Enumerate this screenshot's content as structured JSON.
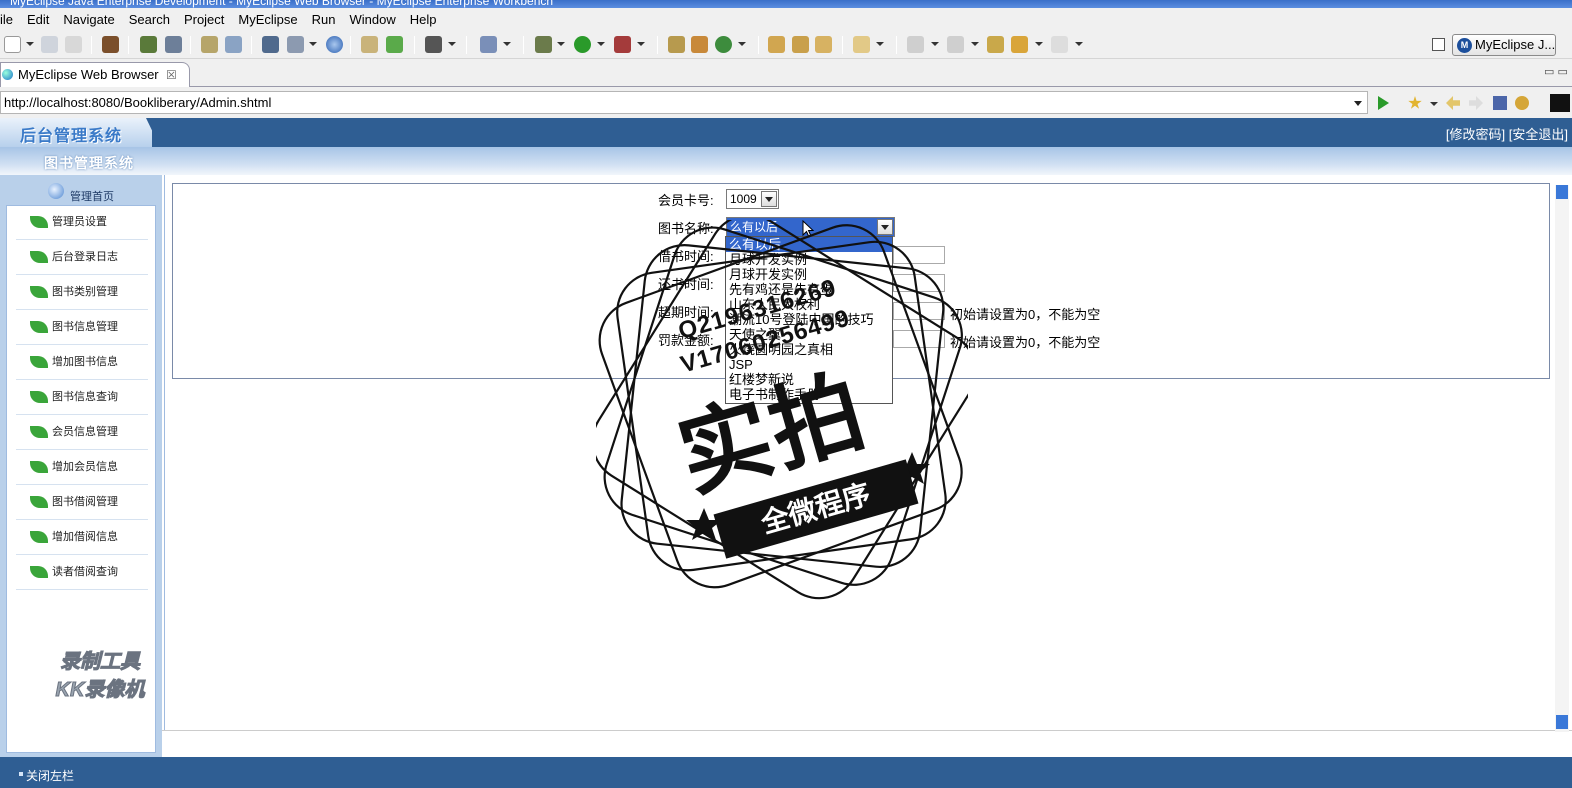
{
  "window": {
    "title": "MyEclipse Java Enterprise Development - MyEclipse Web Browser - MyEclipse Enterprise Workbench"
  },
  "menu": [
    "ile",
    "Edit",
    "Navigate",
    "Search",
    "Project",
    "MyEclipse",
    "Run",
    "Window",
    "Help"
  ],
  "perspective": {
    "label": "MyEclipse J..."
  },
  "editor_tab": {
    "label": "MyEclipse Web Browser",
    "close": "☒"
  },
  "address": {
    "url": "http://localhost:8080/Bookliberary/Admin.shtml"
  },
  "web": {
    "logo": "后台管理系统",
    "system_name": "图书管理系统",
    "top_links": {
      "change_password": "[修改密码]",
      "logout": "[安全退出]"
    },
    "sidebar": {
      "home": "管理首页",
      "items": [
        "管理员设置",
        "后台登录日志",
        "图书类别管理",
        "图书信息管理",
        "增加图书信息",
        "图书信息查询",
        "会员信息管理",
        "增加会员信息",
        "图书借阅管理",
        "增加借阅信息",
        "读者借阅查询"
      ]
    },
    "form": {
      "member_card_label": "会员卡号:",
      "member_card_value": "1009",
      "book_name_label": "图书名称:",
      "book_name_value": "么有以后",
      "borrow_time_label": "借书时间:",
      "return_time_label": "还书时间:",
      "overdue_time_label": "超期时间:",
      "fine_label": "罚款金额:",
      "overdue_hint": "初始请设置为0，不能为空",
      "fine_hint": "初始请设置为0，不能为空",
      "book_options": [
        "么有以后",
        "月球开发实例",
        "月球开发实例",
        "先有鸡还是先有蛋",
        "山东人民大权利",
        "潮流10号登陆中国的技巧",
        "天使之翼",
        "火烧圆明园之真相",
        "JSP",
        "红楼梦新说",
        "电子书制作手册"
      ]
    },
    "close_sidebar": "关闭左栏"
  },
  "overlays": {
    "kk_watermark": [
      "录制工具",
      "KK录像机"
    ],
    "stamp": {
      "q": "Q2196316269",
      "v": "V17060256499",
      "main": "实拍",
      "ribbon": "全微程序"
    }
  },
  "icons": [
    "new-icon",
    "save-icon",
    "print-icon",
    "package-icon",
    "debug-icon",
    "run-icon",
    "search-icon",
    "browser-back-icon",
    "browser-forward-icon",
    "go-icon",
    "globe-icon"
  ],
  "colors": {
    "header_blue": "#2f5e93",
    "sidebar_blue": "#b9d0ea",
    "selection_blue": "#3366cc"
  }
}
